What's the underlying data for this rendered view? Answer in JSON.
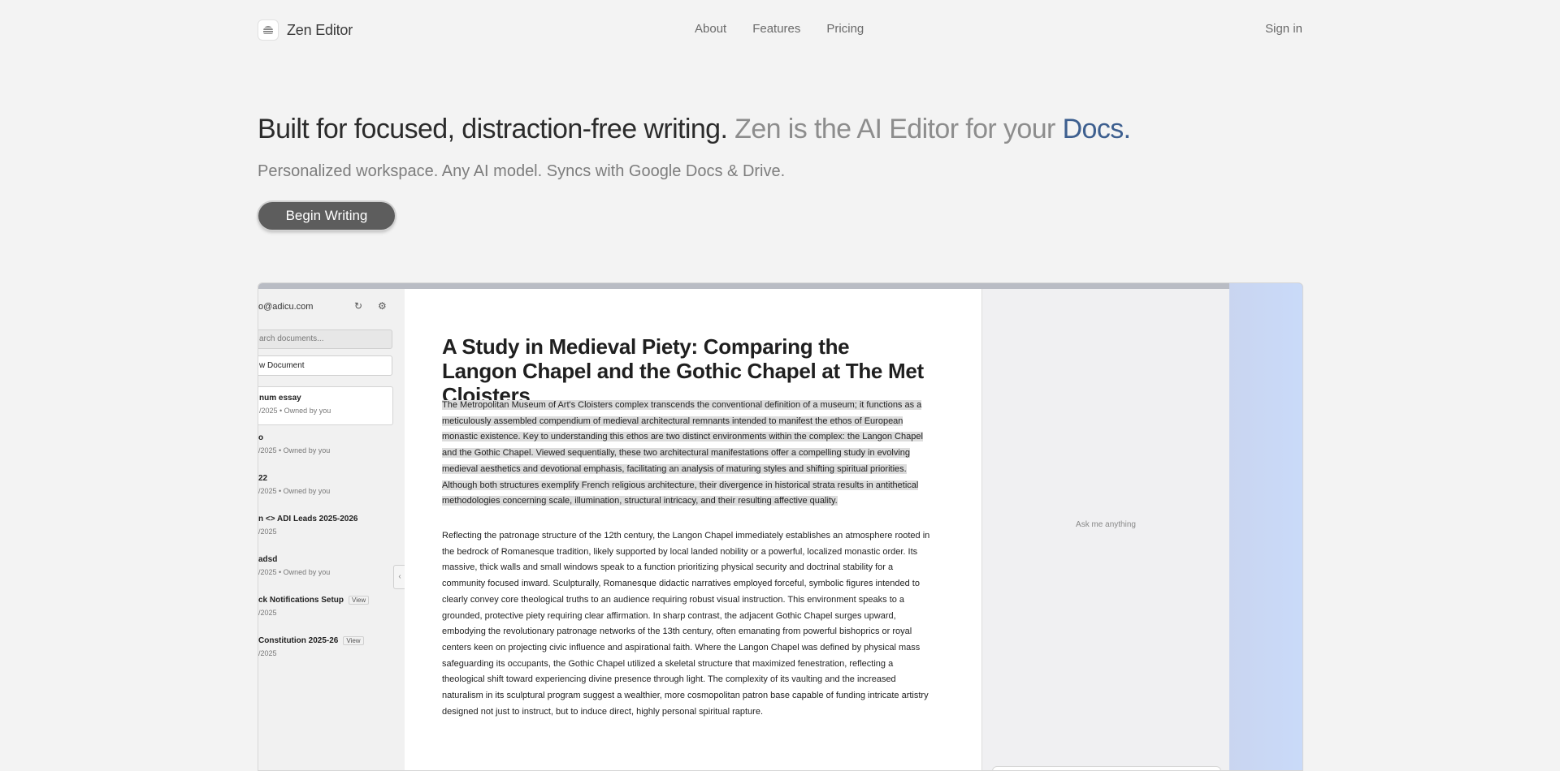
{
  "nav": {
    "brand": "Zen Editor",
    "links": [
      "About",
      "Features",
      "Pricing"
    ],
    "signin": "Sign in"
  },
  "hero": {
    "title_dark": "Built for focused, distraction-free writing.",
    "title_muted": "Zen is the AI Editor for your",
    "title_accent": "Docs",
    "title_end": ".",
    "subtitle": "Personalized workspace. Any AI model. Syncs with Google Docs & Drive.",
    "cta": "Begin Writing"
  },
  "preview": {
    "sidebar": {
      "email": "o@adicu.com",
      "search_placeholder": "arch documents...",
      "new_document": "w Document",
      "documents": [
        {
          "title": "num essay",
          "meta": "/2025 • Owned by you",
          "active": true,
          "view": ""
        },
        {
          "title": "o",
          "meta": "/2025 • Owned by you",
          "active": false,
          "view": ""
        },
        {
          "title": "22",
          "meta": "/2025 • Owned by you",
          "active": false,
          "view": ""
        },
        {
          "title": "n <> ADI Leads 2025-2026",
          "meta": "/2025",
          "active": false,
          "view": ""
        },
        {
          "title": "adsd",
          "meta": "/2025 • Owned by you",
          "active": false,
          "view": ""
        },
        {
          "title": "ck Notifications Setup",
          "meta": "/2025",
          "active": false,
          "view": "View"
        },
        {
          "title": "Constitution 2025-26",
          "meta": "/2025",
          "active": false,
          "view": "View"
        }
      ]
    },
    "document": {
      "title": "A Study in Medieval Piety: Comparing the Langon Chapel and the Gothic Chapel at The Met Cloisters",
      "paragraph1": "The Metropolitan Museum of Art's Cloisters complex transcends the conventional definition of a museum; it functions as a meticulously assembled compendium of medieval architectural remnants intended to manifest the ethos of European monastic existence. Key to understanding this ethos are two distinct environments within the complex: the Langon Chapel and the Gothic Chapel. Viewed sequentially, these two architectural manifestations offer a compelling study in evolving medieval aesthetics and devotional emphasis, facilitating an analysis of maturing styles and shifting spiritual priorities. Although both structures exemplify French religious architecture, their divergence in historical strata results in antithetical methodologies concerning scale, illumination, structural intricacy, and their resulting affective quality.",
      "paragraph2": "Reflecting the patronage structure of the 12th century, the Langon Chapel immediately establishes an atmosphere rooted in the bedrock of Romanesque tradition, likely supported by local landed nobility or a powerful, localized monastic order. Its massive, thick walls and small windows speak to a function prioritizing physical security and doctrinal stability for a community focused inward. Sculpturally, Romanesque didactic narratives employed forceful, symbolic figures intended to clearly convey core theological truths to an audience requiring robust visual instruction. This environment speaks to a grounded, protective piety requiring clear affirmation. In sharp contrast, the adjacent Gothic Chapel surges upward, embodying the revolutionary patronage networks of the 13th century, often emanating from powerful bishoprics or royal centers keen on projecting civic influence and aspirational faith. Where the Langon Chapel was defined by physical mass safeguarding its occupants, the Gothic Chapel utilized a skeletal structure that maximized fenestration, reflecting a theological shift toward experiencing divine presence through light. The complexity of its vaulting and the increased naturalism in its sculptural program suggest a wealthier, more cosmopolitan patron base capable of funding intricate artistry designed not just to instruct, but to induce direct, highly personal spiritual rapture."
    },
    "ai_panel": {
      "prompt": "Ask me anything"
    },
    "icons": {
      "refresh": "refresh-icon",
      "settings": "gear-icon",
      "collapse_left": "chevron-left-icon",
      "collapse_right": "chevron-right-icon"
    }
  },
  "colors": {
    "background": "#f3f3f3",
    "accent": "#3d5f8f",
    "cta_bg": "#5d5d5d"
  }
}
